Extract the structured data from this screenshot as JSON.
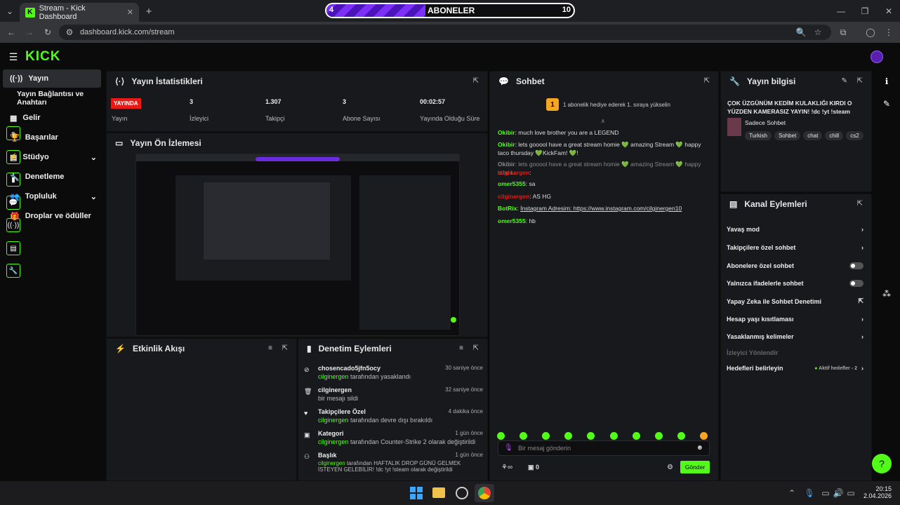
{
  "browser": {
    "tab_title": "Stream - Kick Dashboard",
    "url": "dashboard.kick.com/stream"
  },
  "subgoal": {
    "current": "4",
    "label": "ABONELER",
    "target": "10",
    "progress": 0.4
  },
  "sidebar": {
    "items": [
      {
        "label": "Yayın"
      },
      {
        "label": "Yayın Bağlantısı ve Anahtarı"
      },
      {
        "label": "Gelir"
      },
      {
        "label": "Başarılar"
      },
      {
        "label": "Stüdyo"
      },
      {
        "label": "Denetleme"
      },
      {
        "label": "Topluluk"
      },
      {
        "label": "Droplar ve ödüller"
      }
    ]
  },
  "stats": {
    "title": "Yayın İstatistikleri",
    "live": "YAYINDA",
    "live_label": "Yayın",
    "viewers": "3",
    "viewers_label": "İzleyici",
    "followers": "1.307",
    "followers_label": "Takipçi",
    "subs": "3",
    "subs_label": "Abone Sayısı",
    "duration": "00:02:57",
    "duration_label": "Yayında Olduğu Süre"
  },
  "preview": {
    "title": "Yayın Ön İzlemesi"
  },
  "activity": {
    "title": "Etkinlik Akışı"
  },
  "moderation": {
    "title": "Denetim Eylemleri",
    "items": [
      {
        "title": "chosencado5jfn5ocy",
        "user": "cilginergen",
        "action": "tarafından yasaklandı",
        "time": "30 saniye önce"
      },
      {
        "title": "cilginergen",
        "user": "",
        "action": "bir mesajı sildi",
        "time": "32 saniye önce"
      },
      {
        "title": "Takipçilere Özel",
        "user": "cilginergen",
        "action": "tarafından devre dışı bırakıldı",
        "time": "4 dakika önce"
      },
      {
        "title": "Kategori",
        "user": "cilginergen",
        "action": "tarafından Counter-Strike 2 olarak değiştirildi",
        "time": "1 gün önce"
      },
      {
        "title": "Başlık",
        "user": "cilginergen",
        "action": "tarafından HAFTALIK DROP GÜNÜ GELMEK İSTEYEN GELEBİLİR! !dc !yt !steam olarak değiştirildi",
        "time": "1 gün önce"
      }
    ]
  },
  "chat": {
    "title": "Sohbet",
    "pinned": "1 abonelik hediye ederek 1. sıraya yükselin",
    "messages": [
      {
        "user": "Okibir",
        "text": "much love brother you are a LEGEND"
      },
      {
        "user": "Okibir",
        "text": "lets gooool have a great stream homie 💚 amazing Stream 💚 happy taco thursday 💚KickFam! 💚!"
      },
      {
        "user": "Okibir",
        "text": "lets gooool have a great stream homie 💚 amazing Stream 💚 happy taco t..."
      },
      {
        "user": "cilginergen",
        "text": ""
      },
      {
        "user": "omer5355",
        "text": "sa"
      },
      {
        "user": "cilginergen",
        "text": "AS HG"
      },
      {
        "user": "BotRix",
        "text": "İnstagram Adresim: https://www.instagram.com/cilginergen10"
      },
      {
        "user": "omer5355",
        "text": "hb"
      }
    ],
    "placeholder": "Bir mesaj gönderin",
    "send": "Gönder",
    "count": "0"
  },
  "info": {
    "title": "Yayın bilgisi",
    "stream_title": "ÇOK ÜZGÜNÜM KEDİM KULAKLIĞI KIRDI O YÜZDEN KAMERASIZ YAYIN! !dc !yt !steam",
    "category": "Sadece Sohbet",
    "tags": [
      "Turkish",
      "Sohbet",
      "chat",
      "chill",
      "cs2"
    ]
  },
  "channel": {
    "title": "Kanal Eylemleri",
    "items": [
      "Yavaş mod",
      "Takipçilere özel sohbet",
      "Abonelere özel sohbet",
      "Yalnızca ifadelerle sohbet",
      "Yapay Zeka ile Sohbet Denetimi",
      "Hesap yaşı kısıtlaması",
      "Yasaklanmış kelimeler",
      "İzleyici Yönlendir",
      "Hedefleri belirleyin"
    ],
    "active_goals": "Aktif hedefler - 2"
  },
  "taskbar": {
    "time": "20:15",
    "date": "2.04.2026"
  },
  "colors": {
    "accent": "#53fc18",
    "live": "#e91916"
  }
}
